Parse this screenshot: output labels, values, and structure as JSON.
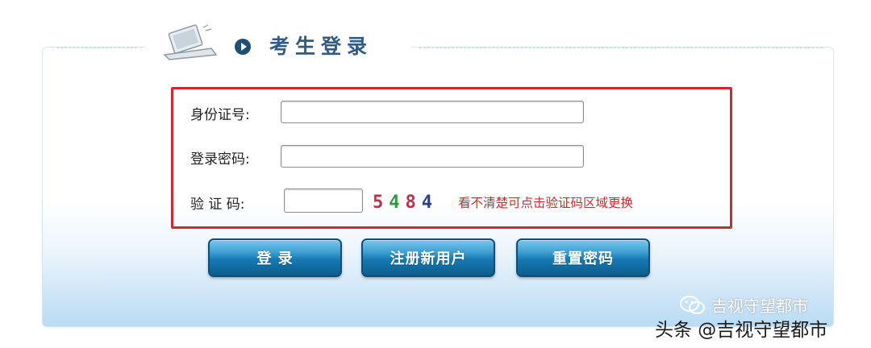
{
  "header": {
    "title": "考生登录"
  },
  "form": {
    "id_label": "身份证号:",
    "id_value": "",
    "password_label": "登录密码:",
    "password_value": "",
    "captcha_label": "验 证 码:",
    "captcha_value": "",
    "captcha_chars": [
      {
        "char": "5",
        "color": "#c0304a"
      },
      {
        "char": "4",
        "color": "#2e9a3a"
      },
      {
        "char": "8",
        "color": "#c0304a"
      },
      {
        "char": "4",
        "color": "#2a3f8f"
      }
    ],
    "captcha_hint": "看不清楚可点击验证码区域更换"
  },
  "buttons": {
    "login": "登 录",
    "register": "注册新用户",
    "reset": "重置密码"
  },
  "watermark": {
    "wechat_text": "吉视守望都市",
    "toutiao_text": "头条 @吉视守望都市"
  },
  "icons": {
    "header_icon": "laptop-icon",
    "bullet_icon": "arrow-right-circle-icon",
    "watermark_icon": "wechat-icon"
  },
  "colors": {
    "frame_highlight": "#d4262d",
    "title": "#2f5b84",
    "button": "#167ab3",
    "hint": "#d42a2a"
  }
}
